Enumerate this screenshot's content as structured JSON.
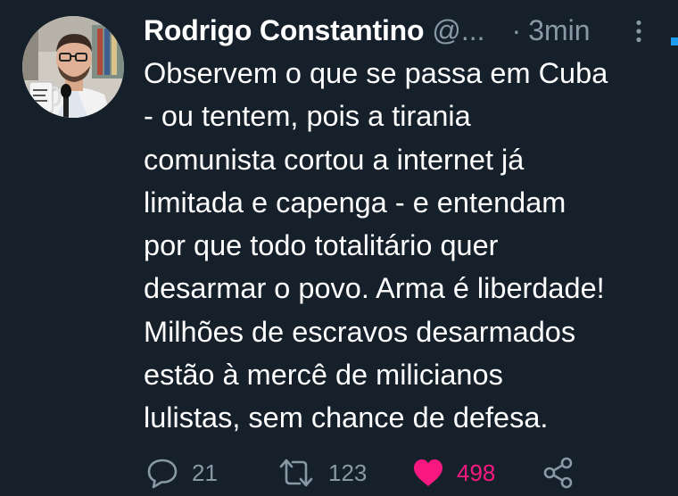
{
  "tweet": {
    "author_name": "Rodrigo Constantino",
    "author_handle": "@...",
    "separator": "·",
    "time": "3min",
    "body_lines": [
      "Observem o que se passa em Cuba",
      "- ou tentem, pois a tirania",
      "comunista cortou a internet já",
      "limitada e capenga - e entendam",
      "por que todo totalitário quer",
      "desarmar o povo. Arma é liberdade!",
      "Milhões de escravos desarmados",
      "estão à mercê de milicianos",
      "lulistas, sem chance de defesa."
    ],
    "avatar_icon": "author-avatar",
    "more_icon": "more-vertical-icon"
  },
  "actions": {
    "reply": {
      "icon": "reply-icon",
      "count": "21"
    },
    "retweet": {
      "icon": "retweet-icon",
      "count": "123"
    },
    "like": {
      "icon": "heart-icon",
      "count": "498",
      "liked": true
    },
    "share": {
      "icon": "share-icon"
    }
  },
  "colors": {
    "background": "#15202b",
    "text_primary": "#ffffff",
    "text_secondary": "#8899a6",
    "like_active": "#f91880",
    "accent": "#1d9bf0"
  }
}
